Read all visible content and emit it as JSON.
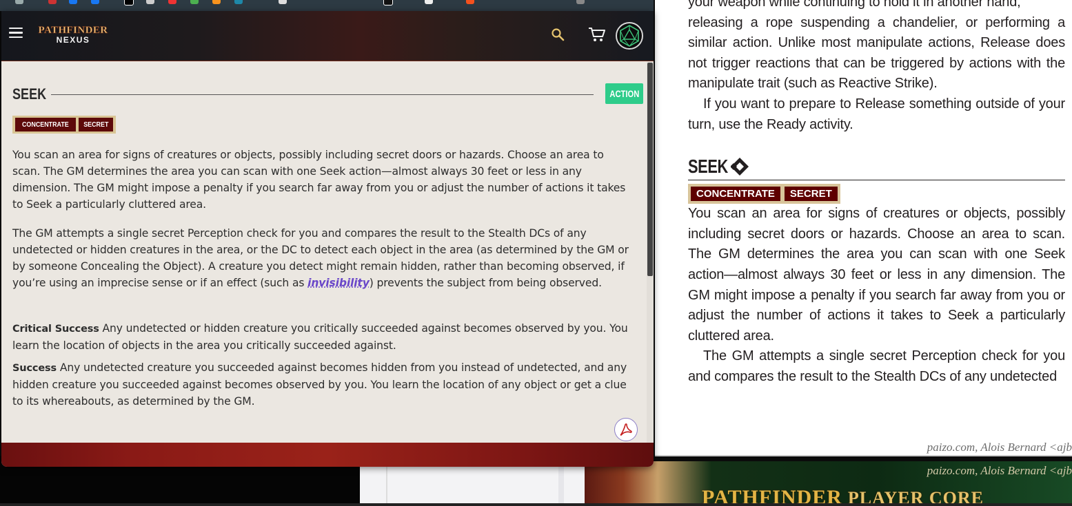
{
  "popup": {
    "nav": {
      "logo_top": "PATHFINDER",
      "logo_bottom": "NEXUS"
    },
    "seek_title": "SEEK",
    "action_badge": "ACTION",
    "traits": [
      "CONCENTRATE",
      "SECRET"
    ],
    "paragraph1": "You scan an area for signs of creatures or objects, possibly including secret doors or hazards. Choose an area to scan. The GM determines the area you can scan with one Seek action—almost always 30 feet or less in any dimension. The GM might impose a penalty if you search far away from you or adjust the number of actions it takes to Seek a particularly cluttered area.",
    "paragraph2_before_link": "The GM attempts a single secret Perception check for you and compares the result to the Stealth DCs of any undetected or hidden creatures in the area, or the DC to detect each object in the area (as determined by the GM or by someone Concealing the Object). A creature you detect might remain hidden, rather than becoming observed, if you’re using an imprecise sense or if an effect (such as ",
    "paragraph2_link": "invisibility",
    "paragraph2_after_link": ") prevents the subject from being observed.",
    "critical_success_label": "Critical Success",
    "critical_success_text": " Any undetected or hidden creature you critically succeeded against becomes observed by you. You learn the location of objects in the area you critically succeeded against.",
    "success_label": "Success",
    "success_text": " Any undetected creature you succeeded against becomes hidden from you instead of undetected, and any hidden creature you succeeded against becomes observed by you. You learn the location of any object or get a clue to its whereabouts, as determined by the GM."
  },
  "pdf": {
    "line_partial": "your weapon while continuing to hold it in another hand,",
    "para_release": "releasing a rope suspending a chandelier, or performing a similar action. Unlike most manipulate actions, Release does not trigger reactions that can be triggered by actions with the manipulate trait (such as Reactive Strike).",
    "para_ready": "If you want to prepare to Release something outside of your turn, use the Ready activity.",
    "seek_heading": "SEEK",
    "traits": [
      "CONCENTRATE",
      "SECRET"
    ],
    "para_seek1": "You scan an area for signs of creatures or objects, possibly including secret doors or hazards. Choose an area to scan. The GM determines the area you can scan with one Seek action—almost always 30 feet or less in any dimension. The GM might impose a penalty if you search far away from you or adjust the number of actions it takes to Seek a particularly cluttered area.",
    "para_seek2": "The GM attempts a single secret Perception check for you and compares the result to the Stealth DCs of any undetected",
    "footer": "paizo.com, Alois Bernard <ajb",
    "footer2": "paizo.com, Alois Bernard <ajb",
    "cover_logo": "PATHFINDER",
    "cover_logo_sub": "PLAYER CORE"
  },
  "colors": {
    "action_badge": "#2ecc8a",
    "trait_bg": "#5d0a0a",
    "trait_border": "#d9c594",
    "link": "#6a47c9",
    "content_bg": "#ebe7e1"
  },
  "icons": [
    "menu-icon",
    "search-icon",
    "cart-icon",
    "d20-avatar-icon",
    "pdf-icon",
    "action-icon"
  ]
}
